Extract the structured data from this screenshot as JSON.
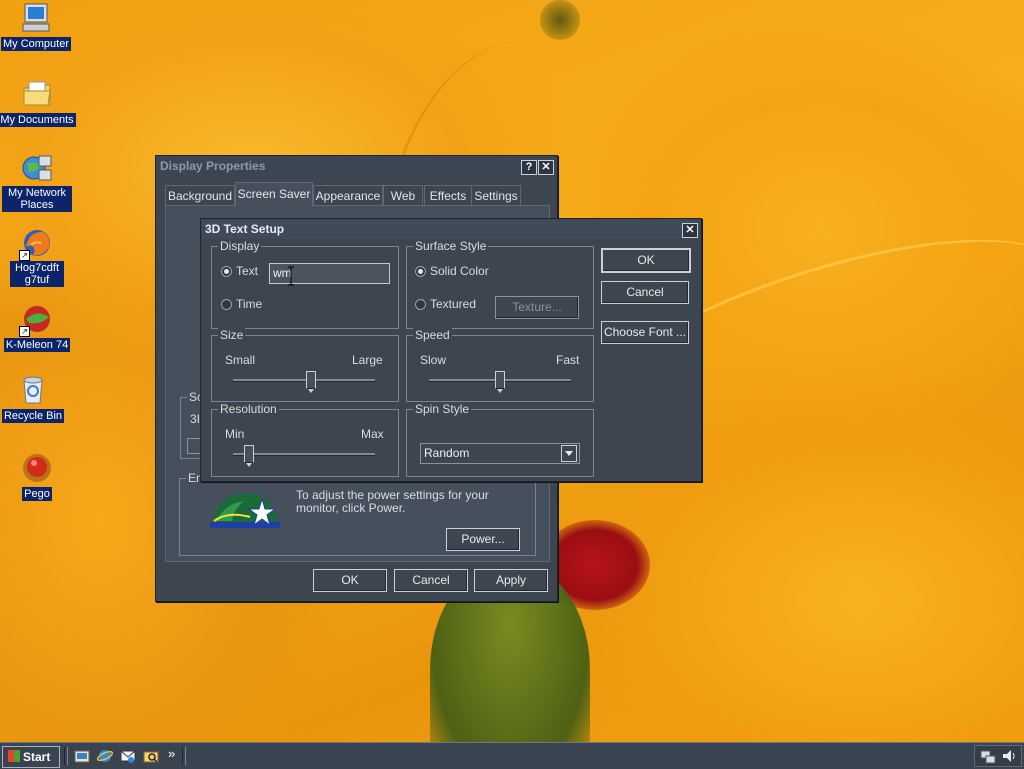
{
  "desktop_icons": [
    {
      "label": "My Computer",
      "icon": "computer-icon"
    },
    {
      "label": "My Documents",
      "icon": "folder-icon"
    },
    {
      "label": "My Network Places",
      "icon": "network-places-icon"
    },
    {
      "label": "Hog7cdft g7tuf",
      "icon": "firefox-icon"
    },
    {
      "label": "K-Meleon 74",
      "icon": "kmeleon-icon"
    },
    {
      "label": "Recycle Bin",
      "icon": "recycle-bin-icon"
    },
    {
      "label": "Pego",
      "icon": "pego-icon"
    }
  ],
  "display_properties": {
    "title": "Display Properties",
    "help_btn": "?",
    "close_btn": "✕",
    "tabs": [
      "Background",
      "Screen Saver",
      "Appearance",
      "Web",
      "Effects",
      "Settings"
    ],
    "active_tab": "Screen Saver",
    "screensaver_group_partial": "Sc",
    "screensaver_value_partial": "3I",
    "energy_group_partial": "En",
    "energy_text": "To adjust the power settings for your monitor, click Power.",
    "power_button": "Power...",
    "ok": "OK",
    "cancel": "Cancel",
    "apply": "Apply"
  },
  "text_setup": {
    "title": "3D Text Setup",
    "close_btn": "✕",
    "display_group": "Display",
    "text_radio": "Text",
    "text_value": "wm",
    "time_radio": "Time",
    "surface_group": "Surface Style",
    "solid_color": "Solid Color",
    "textured": "Textured",
    "texture_button": "Texture...",
    "size_group": "Size",
    "size_small": "Small",
    "size_large": "Large",
    "size_level": 0.55,
    "speed_group": "Speed",
    "speed_slow": "Slow",
    "speed_fast": "Fast",
    "speed_level": 0.5,
    "resolution_group": "Resolution",
    "res_min": "Min",
    "res_max": "Max",
    "res_level": 0.08,
    "spin_group": "Spin Style",
    "spin_value": "Random",
    "ok": "OK",
    "cancel": "Cancel",
    "choose_font": "Choose Font ..."
  },
  "taskbar": {
    "start": "Start",
    "quick_launch": [
      "show-desktop-icon",
      "ie-icon",
      "outlook-icon",
      "explorer-icon"
    ],
    "chevron": "»"
  }
}
